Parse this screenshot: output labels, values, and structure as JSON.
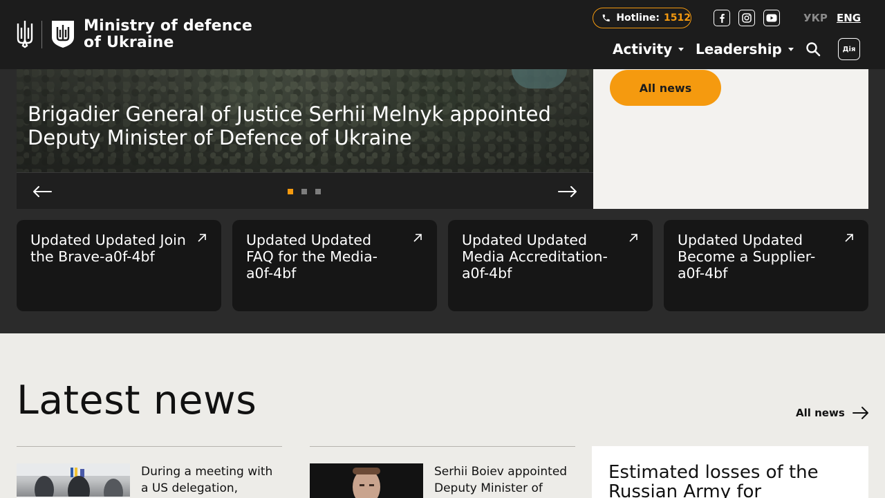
{
  "header": {
    "logo_line1": "Ministry of defence",
    "logo_line2": "of Ukraine",
    "hotline_label": "Hotline:",
    "hotline_number": "1512",
    "lang_ukr": "УКР",
    "lang_eng": "ENG",
    "nav": [
      {
        "label": "Activity"
      },
      {
        "label": "Leadership"
      }
    ],
    "diia_label": "Дія",
    "social_icons": [
      "facebook-icon",
      "instagram-icon",
      "youtube-icon"
    ]
  },
  "hero": {
    "title": "Brigadier General of Justice Serhii Melnyk appointed Deputy Minister of Defence of Ukraine",
    "active_slide": 1,
    "slide_count": 3,
    "all_news_button": "All news"
  },
  "cards": [
    {
      "title": "Updated Updated Join the Brave-a0f-4bf"
    },
    {
      "title": "Updated Updated FAQ for the Media-a0f-4bf"
    },
    {
      "title": "Updated Updated Media Accreditation-a0f-4bf"
    },
    {
      "title": "Updated Updated Become a Supplier-a0f-4bf"
    }
  ],
  "latest": {
    "heading": "Latest news",
    "all_news_link": "All news",
    "items": [
      {
        "text": "During a meeting with a US delegation,"
      },
      {
        "text": "Serhii Boiev appointed Deputy Minister of"
      }
    ],
    "losses_title": "Estimated losses of the Russian Army for"
  },
  "colors": {
    "accent": "#f59a0f",
    "header_bg": "#1c1c1c",
    "band_bg": "#2b2b2b",
    "page_bg": "#edece8"
  }
}
